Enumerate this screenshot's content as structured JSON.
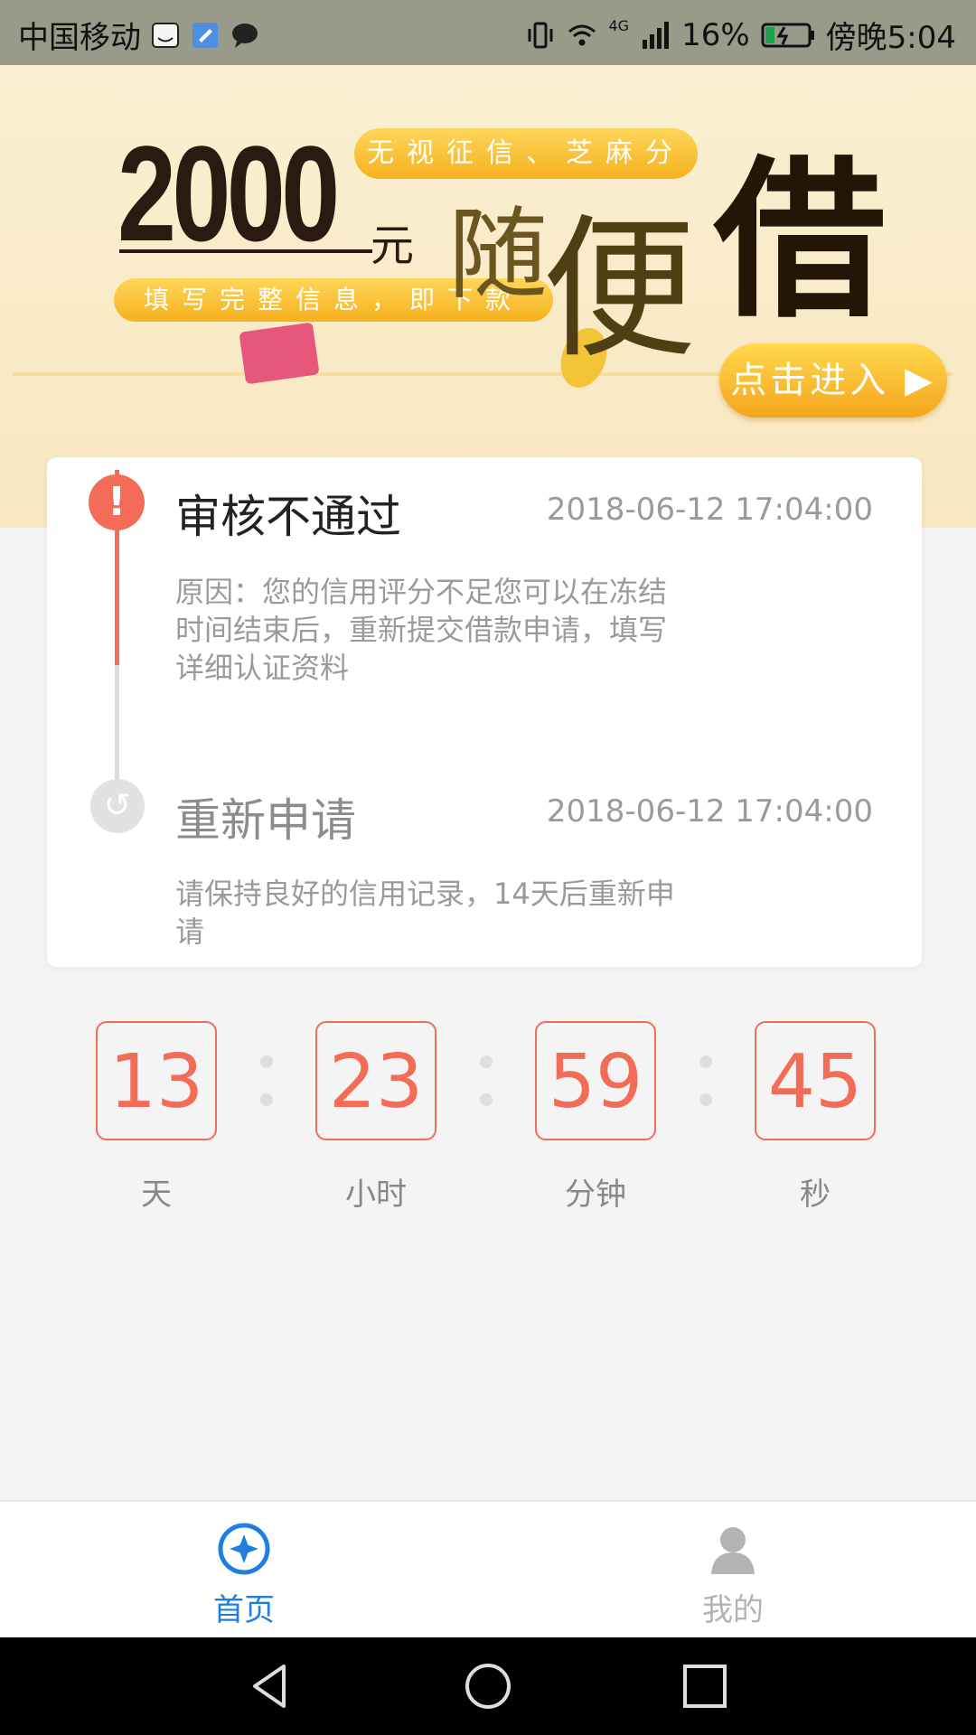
{
  "status_bar": {
    "carrier": "中国移动",
    "network": "4G",
    "battery": "16%",
    "time": "傍晚5:04"
  },
  "banner": {
    "amount": "2000",
    "unit": "元",
    "tag_top": "无视征信、芝麻分",
    "tag_bottom": "填写完整信息，即下款",
    "slogan_1": "随",
    "slogan_2": "便",
    "slogan_3": "借",
    "enter_button": "点击进入 ▶"
  },
  "timeline": {
    "steps": [
      {
        "title": "审核不通过",
        "time": "2018-06-12 17:04:00",
        "desc": "原因：您的信用评分不足您可以在冻结时间结束后，重新提交借款申请，填写详细认证资料"
      },
      {
        "title": "重新申请",
        "time": "2018-06-12 17:04:00",
        "desc": "请保持良好的信用记录，14天后重新申请"
      }
    ]
  },
  "countdown": {
    "days": "13",
    "hours": "23",
    "minutes": "59",
    "seconds": "45",
    "labels": {
      "days": "天",
      "hours": "小时",
      "minutes": "分钟",
      "seconds": "秒"
    }
  },
  "tabbar": {
    "home": "首页",
    "mine": "我的",
    "active_color": "#1e7fe0",
    "inactive_color": "#b3b3b3"
  }
}
